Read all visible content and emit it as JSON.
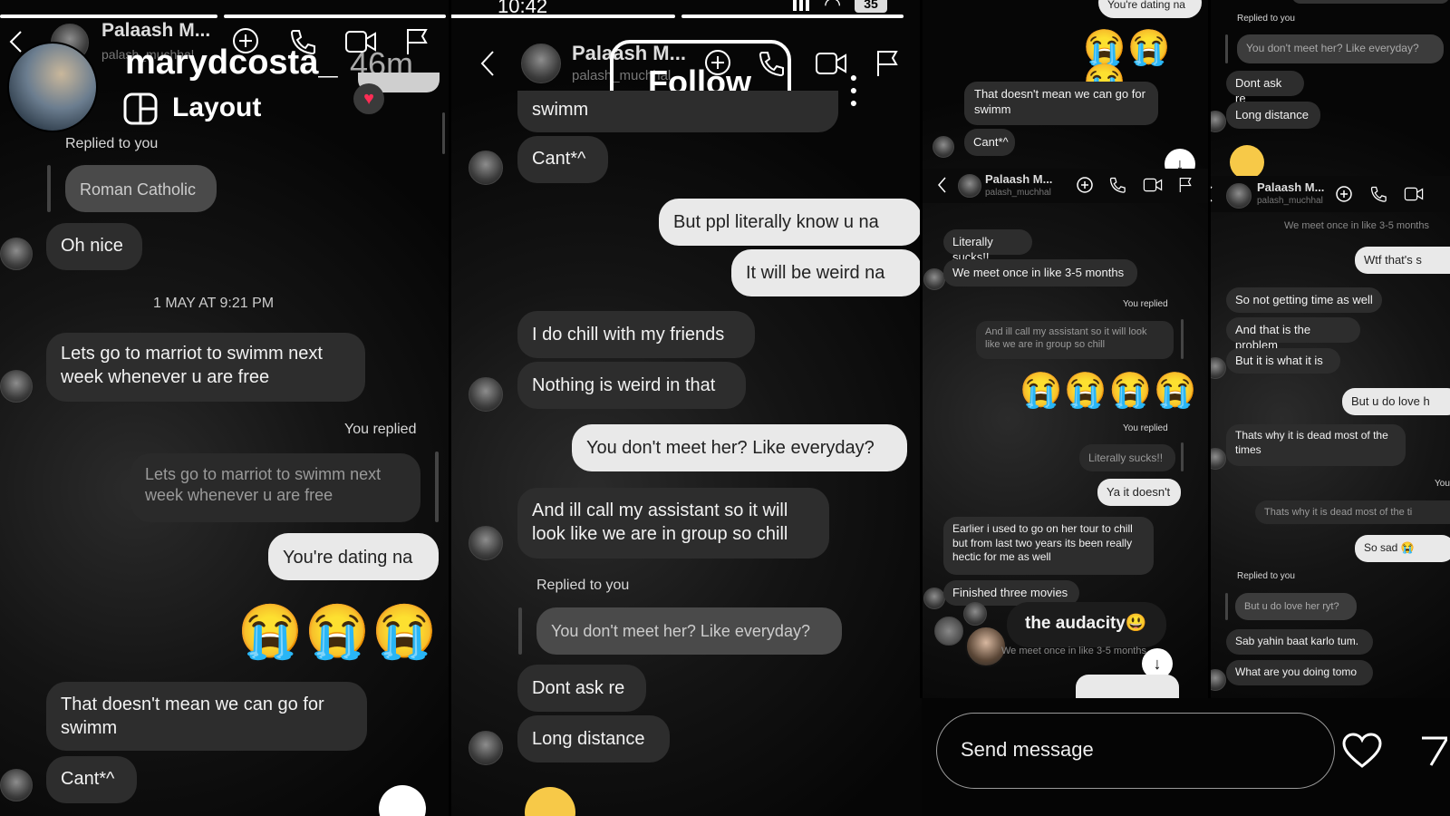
{
  "colors": {
    "incoming": "#2d2d2d",
    "outgoing": "#e9e9e9",
    "background": "#0a0a0a"
  },
  "status": {
    "time": "10:42",
    "battery": "35"
  },
  "overlay": {
    "username": "marydcosta_",
    "time_ago": "46m",
    "layout_label": "Layout",
    "follow_label": "Follow",
    "reaction_text": "the audacity😃"
  },
  "p1": {
    "header": {
      "name": "Palaash M...",
      "username": "palash_muchhal"
    },
    "replied_to_you": "Replied to you",
    "quote1": "Roman Catholic",
    "m1": "Oh nice",
    "date": "1 MAY AT 9:21 PM",
    "m2": "Lets go to marriot to swimm next week whenever u are free",
    "you_replied": "You replied",
    "quote2": "Lets go to marriot to swimm next week whenever u are free",
    "m3": "You're dating na",
    "emojis": "😭😭😭",
    "m4": "That doesn't mean we can go for swimm",
    "m5": "Cant*^"
  },
  "p2": {
    "header": {
      "name": "Palaash M...",
      "username": "palash_muchhal"
    },
    "m0": "swimm",
    "m1": "Cant*^",
    "m2": "But ppl literally know u na",
    "m3": "It will be weird na",
    "m4": "I do chill with my friends",
    "m5": "Nothing is weird in that",
    "m6": "You don't meet her? Like everyday?",
    "m7": "And ill call my assistant so it will look like we are in group so chill",
    "replied_to_you": "Replied to you",
    "quote": "You don't meet her? Like everyday?",
    "m8": "Dont ask re",
    "m9": "Long distance"
  },
  "p3": {
    "m0": "You're dating na",
    "emojis_top": "😭😭😭",
    "m1": "That doesn't mean we can go for swimm",
    "m2": "Cant*^",
    "header": {
      "name": "Palaash M...",
      "username": "palash_muchhal"
    },
    "m3": "Literally sucks!!",
    "m4": "We meet  once in like 3-5 months",
    "you_replied1": "You replied",
    "quote1": "And ill call my assistant so it will look like we are in group so chill",
    "emojis_mid": "😭😭😭😭",
    "you_replied2": "You replied",
    "quote2": "Literally sucks!!",
    "m5": "Ya it doesn't",
    "m6": "Earlier i used to go on her tour to chill but from last two years its been really hectic for me as well",
    "m7": "Finished three movies",
    "quote3": "We meet  once in like 3-5 months"
  },
  "p4": {
    "replied_to_you": "Replied to you",
    "quote1": "You don't meet her? Like everyday?",
    "m1": "Dont ask re",
    "m2": "Long distance",
    "header": {
      "name": "Palaash M...",
      "username": "palash_muchhal"
    },
    "quote_top": "We meet  once in like 3-5 months",
    "m3": "Wtf that's s",
    "m4": "So not getting time as well",
    "m5": "And that is the problem",
    "m6": "But it is what it is",
    "m7": "But u do love h",
    "m8": "Thats why it is dead most of the times",
    "m8b": "You",
    "quote2": "Thats why it is dead most of the ti",
    "m9": "So sad 😭",
    "replied_to_you2": "Replied to you",
    "quote3": "But u do love her ryt?",
    "m10": "Sab yahin baat karlo tum.",
    "m11": "What are you doing tomo"
  },
  "composer": {
    "placeholder": "Send message"
  }
}
